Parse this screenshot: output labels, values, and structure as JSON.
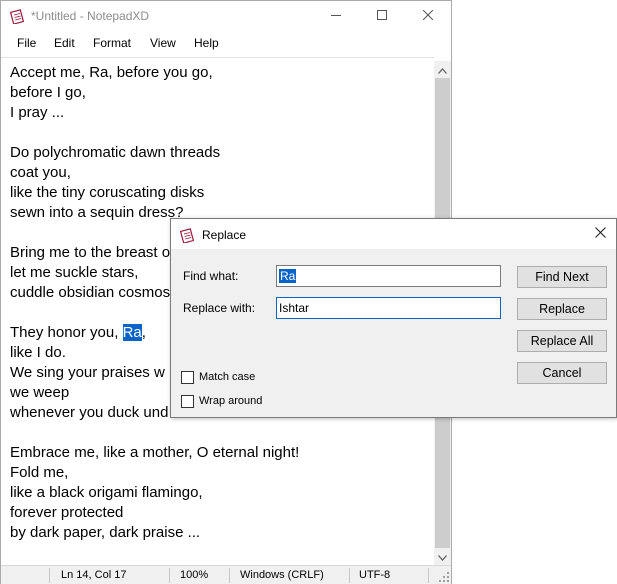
{
  "window": {
    "title": "*Untitled - NotepadXD"
  },
  "menu": {
    "items": [
      {
        "label": "File"
      },
      {
        "label": "Edit"
      },
      {
        "label": "Format"
      },
      {
        "label": "View"
      },
      {
        "label": "Help"
      }
    ]
  },
  "editor": {
    "lines": [
      "Accept me, Ra, before you go,",
      "before I go,",
      "I pray ...",
      "",
      "Do polychromatic dawn threads",
      "coat you,",
      "like the tiny coruscating disks",
      "sewn into a sequin dress?",
      "",
      "Bring me to the breast o",
      "let me suckle stars,",
      "cuddle obsidian cosmos",
      "",
      "They honor you, ",
      "like I do.",
      "We sing your praises w",
      "we weep",
      "whenever you duck und",
      "",
      "Embrace me, like a mother, O eternal night!",
      "Fold me,",
      "like a black origami flamingo,",
      "forever protected",
      "by dark paper, dark praise ..."
    ],
    "selected_text": "Ra",
    "after_selection": ","
  },
  "status": {
    "position": "Ln 14, Col 17",
    "zoom": "100%",
    "line_ending": "Windows (CRLF)",
    "encoding": "UTF-8"
  },
  "dialog": {
    "title": "Replace",
    "find_label": "Find what:",
    "find_value": "Ra",
    "replace_label": "Replace with:",
    "replace_value": "Ishtar",
    "buttons": {
      "find_next": "Find Next",
      "replace": "Replace",
      "replace_all": "Replace All",
      "cancel": "Cancel"
    },
    "match_case_label": "Match case",
    "match_case_checked": false,
    "wrap_around_label": "Wrap around",
    "wrap_around_checked": false
  },
  "colors": {
    "selection": "#0a64c8",
    "dialog_bg": "#f0f0f0",
    "button_bg": "#e1e1e1"
  },
  "icons": [
    "notepad-icon",
    "minimize-icon",
    "maximize-icon",
    "close-icon",
    "scroll-up-icon",
    "scroll-down-icon",
    "resize-grip-icon"
  ]
}
